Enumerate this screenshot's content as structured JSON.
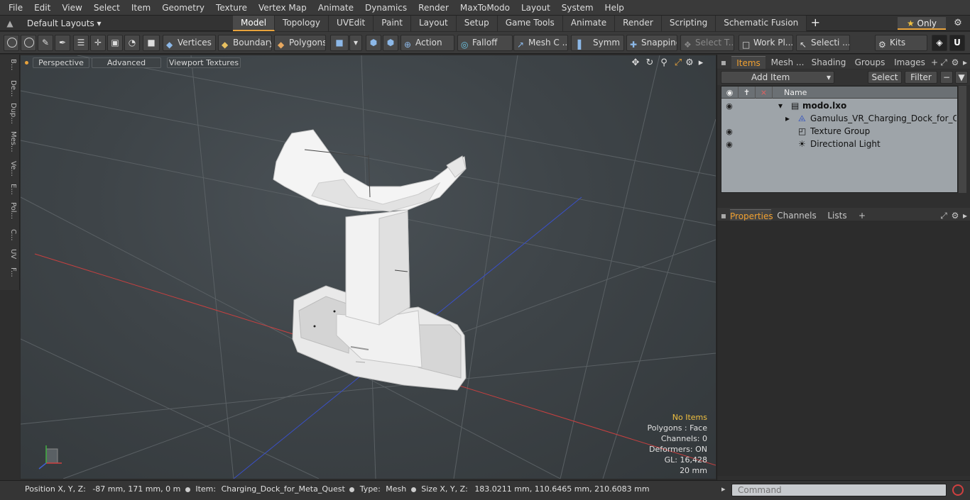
{
  "menu": [
    "File",
    "Edit",
    "View",
    "Select",
    "Item",
    "Geometry",
    "Texture",
    "Vertex Map",
    "Animate",
    "Dynamics",
    "Render",
    "MaxToModo",
    "Layout",
    "System",
    "Help"
  ],
  "layout_selector": "Default Layouts",
  "tabs": [
    "Model",
    "Topology",
    "UVEdit",
    "Paint",
    "Layout",
    "Setup",
    "Game Tools",
    "Animate",
    "Render",
    "Scripting",
    "Schematic Fusion"
  ],
  "active_tab": "Model",
  "only_label": "Only",
  "toolbar": {
    "vertices": "Vertices",
    "boundary": "Boundary",
    "polygons": "Polygons",
    "action": "Action",
    "falloff": "Falloff",
    "mesh_c": "Mesh C ...",
    "symm": "Symm ...",
    "snapping": "Snapping",
    "select_t": "Select T...",
    "work_pl": "Work Pl...",
    "selecti": "Selecti ...",
    "kits": "Kits"
  },
  "left_strip": [
    "B...",
    "De...",
    "Dup...",
    "Mes...",
    "Ve...",
    "E...",
    "Pol...",
    "C...",
    "UV",
    "F..."
  ],
  "viewport": {
    "perspective": "Perspective",
    "advanced": "Advanced",
    "viewport_textures": "Viewport Textures",
    "info": {
      "no_items": "No Items",
      "polygons": "Polygons : Face",
      "channels": "Channels: 0",
      "deformers": "Deformers: ON",
      "gl": "GL: 16,428",
      "scale": "20 mm"
    }
  },
  "items_panel": {
    "tabs": [
      "Items",
      "Mesh ...",
      "Shading",
      "Groups",
      "Images"
    ],
    "add_item": "Add Item",
    "select": "Select",
    "filter": "Filter",
    "name_col": "Name",
    "rows": [
      {
        "label": "modo.lxo",
        "visible": true
      },
      {
        "label": "Gamulus_VR_Charging_Dock_for_Oculu ...",
        "visible": false
      },
      {
        "label": "Texture Group",
        "visible": true
      },
      {
        "label": "Directional Light",
        "visible": true
      }
    ]
  },
  "props_panel": {
    "tabs": [
      "Properties",
      "Channels",
      "Lists"
    ]
  },
  "status": {
    "position_label": "Position X, Y, Z:",
    "position_value": "-87 mm, 171 mm, 0 m",
    "item_label": "Item:",
    "item_value": "Charging_Dock_for_Meta_Quest",
    "type_label": "Type:",
    "type_value": "Mesh",
    "size_label": "Size X, Y, Z:",
    "size_value": "183.0211 mm, 110.6465 mm, 210.6083 mm"
  },
  "command_placeholder": "Command",
  "colors": {
    "accent": "#e8a33c",
    "highlight_text": "#f0c040"
  }
}
